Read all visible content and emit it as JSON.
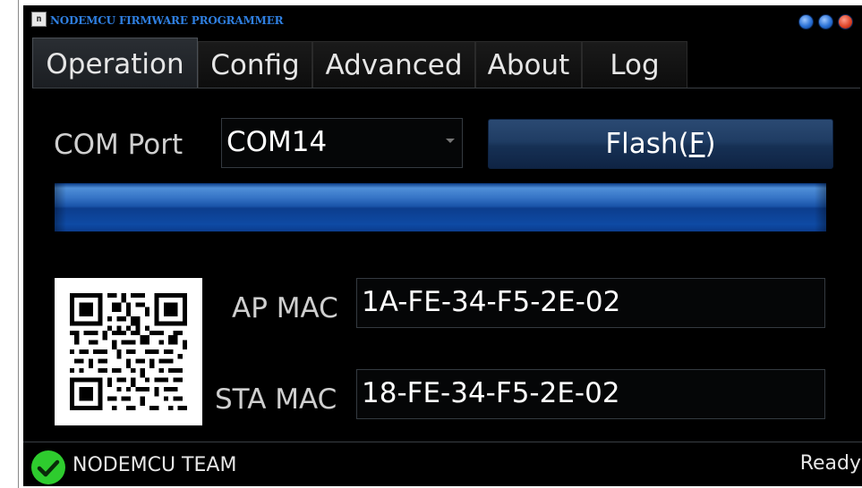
{
  "window": {
    "title": "NODEMCU FIRMWARE PROGRAMMER",
    "app_icon": "programmer-app-icon",
    "controls": [
      "minimize-icon",
      "maximize-icon",
      "close-icon"
    ]
  },
  "tabs": [
    {
      "label": "Operation",
      "active": true
    },
    {
      "label": "Config",
      "active": false
    },
    {
      "label": "Advanced",
      "active": false
    },
    {
      "label": "About",
      "active": false
    },
    {
      "label": "Log",
      "active": false
    }
  ],
  "operation": {
    "com_port_label": "COM Port",
    "com_port_value": "COM14",
    "flash_label_main": "Flash(",
    "flash_label_mnemonic": "F",
    "flash_label_end": ")",
    "progress": 1.0,
    "qr_icon": "qr-code-icon",
    "ap_mac_label": "AP MAC",
    "ap_mac_value": "1A-FE-34-F5-2E-02",
    "sta_mac_label": "STA MAC",
    "sta_mac_value": "18-FE-34-F5-2E-02"
  },
  "status": {
    "icon": "check-circle-icon",
    "team": "NODEMCU TEAM",
    "state": "Ready"
  },
  "colors": {
    "title_text": "#2f7fe0",
    "progress_blue": "#1953a8",
    "status_ok": "#2ecc2e"
  }
}
